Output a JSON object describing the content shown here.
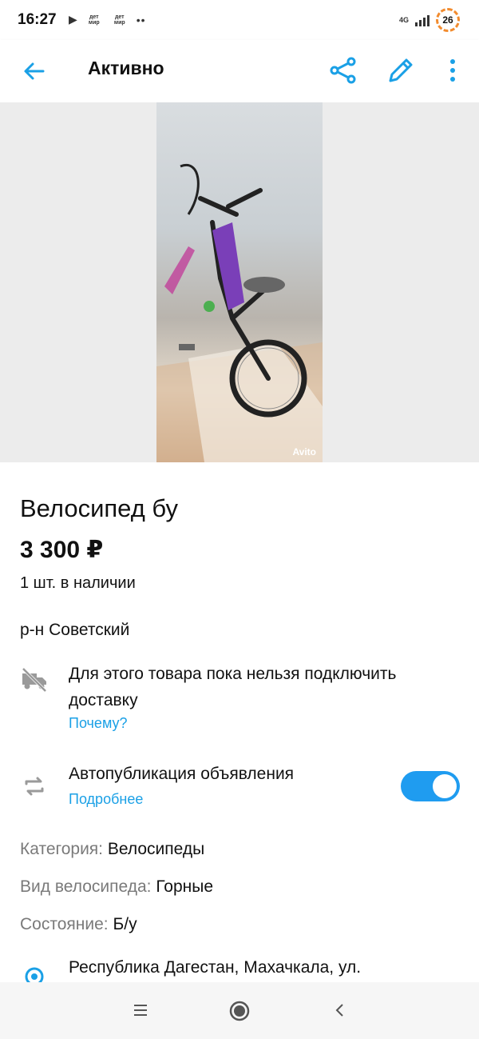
{
  "status_bar": {
    "time": "16:27",
    "notif_logo": "дет мир",
    "network": "4G",
    "battery": "26"
  },
  "app_bar": {
    "title": "Активно",
    "icons": [
      "back-arrow-icon",
      "share-icon",
      "edit-pencil-icon",
      "more-vert-icon"
    ],
    "accent_color": "#1aa0e6"
  },
  "photo": {
    "watermark": "Avito"
  },
  "listing": {
    "title": "Велосипед бу",
    "price": "3 300 ₽",
    "stock": "1 шт. в наличии",
    "district": "р-н Советский"
  },
  "delivery": {
    "text": "Для этого товара пока нельзя подключить доставку",
    "link": "Почему?",
    "icon": "no-delivery-truck-icon"
  },
  "autopublish": {
    "label": "Автопубликация объявления",
    "link": "Подробнее",
    "enabled": true,
    "icon": "repeat-icon",
    "toggle_color": "#1f9cf0"
  },
  "params": [
    {
      "key": "Категория:",
      "value": "Велосипеды"
    },
    {
      "key": "Вид велосипеда:",
      "value": "Горные"
    },
    {
      "key": "Состояние:",
      "value": "Б/у"
    }
  ],
  "address": {
    "text": "Республика Дагестан, Махачкала, ул.",
    "icon": "location-pin-icon"
  },
  "nav_bar": {
    "icons": [
      "recents-icon",
      "home-icon",
      "back-icon"
    ]
  }
}
